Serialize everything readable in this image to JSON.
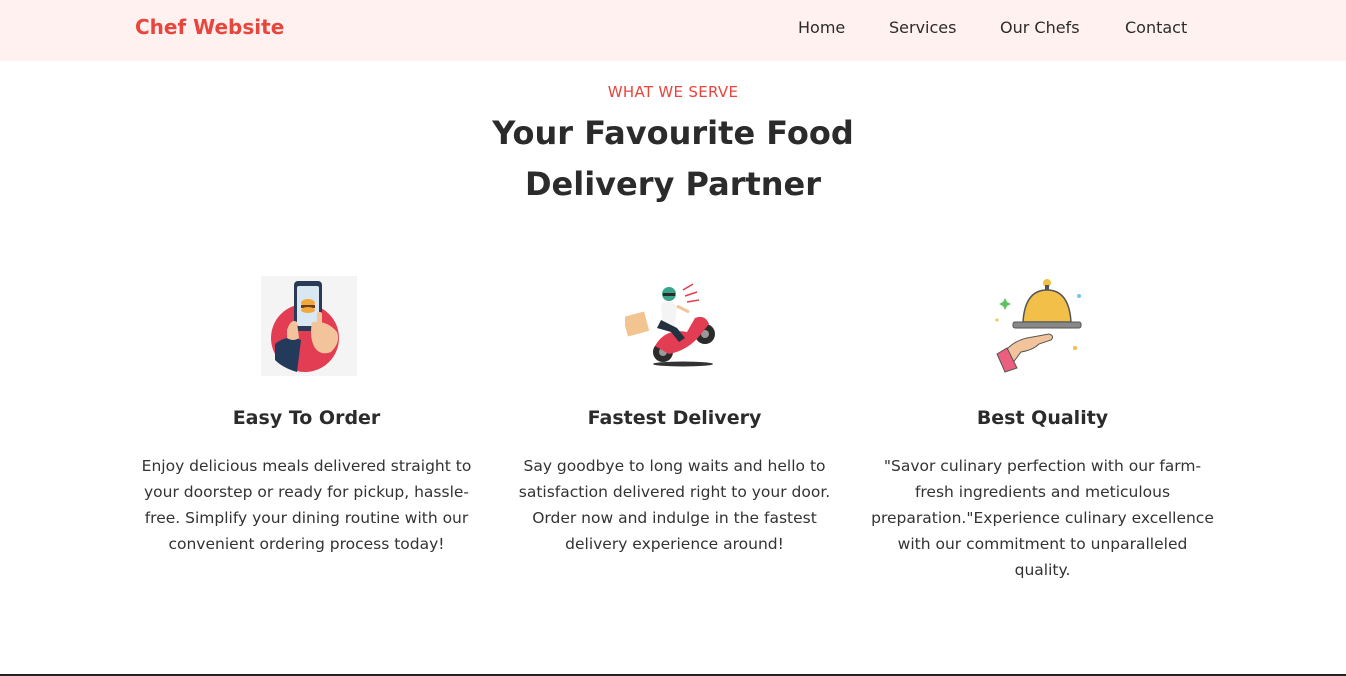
{
  "nav": {
    "brand": "Chef Website",
    "links": [
      "Home",
      "Services",
      "Our Chefs",
      "Contact"
    ]
  },
  "section": {
    "eyebrow": "WHAT WE SERVE",
    "title_line1": "Your Favourite Food",
    "title_line2": "Delivery Partner"
  },
  "cards": [
    {
      "icon": "phone-order-icon",
      "title": "Easy To Order",
      "text": "Enjoy delicious meals delivered straight to your doorstep or ready for pickup, hassle-free. Simplify your dining routine with our convenient ordering process today!"
    },
    {
      "icon": "delivery-scooter-icon",
      "title": "Fastest Delivery",
      "text": "Say goodbye to long waits and hello to satisfaction delivered right to your door. Order now and indulge in the fastest delivery experience around!"
    },
    {
      "icon": "serving-cloche-icon",
      "title": "Best Quality",
      "text": "\"Savor culinary perfection with our farm-fresh ingredients and meticulous preparation.\"Experience culinary excellence with our commitment to unparalleled quality."
    }
  ],
  "colors": {
    "accent": "#e8453c",
    "nav_bg": "#fff1f0",
    "text": "#2b2b2b"
  }
}
